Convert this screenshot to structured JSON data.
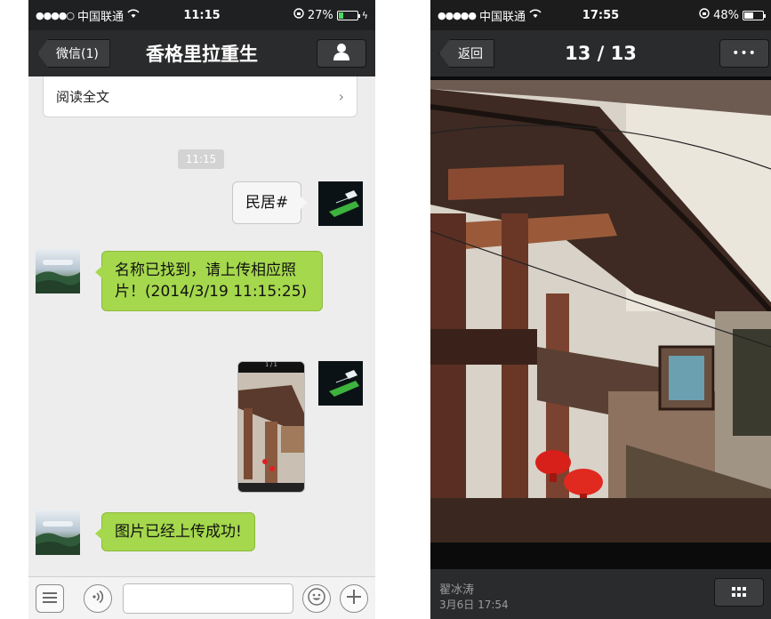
{
  "chat": {
    "status": {
      "carrier": "中国联通",
      "time": "11:15",
      "battery": "27%",
      "battery_level": 0.27
    },
    "nav": {
      "back_label": "微信(1)",
      "title": "香格里拉重生",
      "right_icon": "person-icon"
    },
    "read_more": "阅读全文",
    "timestamp": "11:15",
    "messages": {
      "sent_text": "民居#",
      "reply1": "名称已找到，请上传相应照片！(2014/3/19 11:15:25)",
      "reply2": "图片已经上传成功!"
    },
    "image_msg": {
      "header": "1 / 1"
    },
    "input_bar": {
      "icons": [
        "menu-icon",
        "voice-icon",
        "emoji-icon",
        "plus-icon"
      ]
    }
  },
  "photo_viewer": {
    "status": {
      "carrier": "中国联通",
      "time": "17:55",
      "battery": "48%",
      "battery_level": 0.48
    },
    "nav": {
      "back_label": "返回",
      "title": "13 / 13",
      "more": "•••"
    },
    "author": "翟冰涛",
    "date": "3月6日 17:54"
  },
  "colors": {
    "bubble_green": "#a5d84d",
    "navbar": "#2a2b2c"
  }
}
